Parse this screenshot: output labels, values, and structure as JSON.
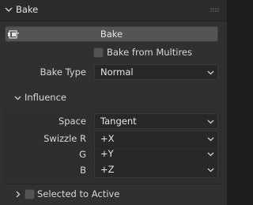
{
  "panel": {
    "title": "Bake",
    "bake_button": "Bake",
    "bake_from_multires": {
      "label": "Bake from Multires",
      "checked": false
    },
    "bake_type": {
      "label": "Bake Type",
      "value": "Normal"
    }
  },
  "influence": {
    "title": "Influence",
    "space": {
      "label": "Space",
      "value": "Tangent"
    },
    "swizzle_r": {
      "label": "Swizzle R",
      "value": "+X"
    },
    "swizzle_g": {
      "label": "G",
      "value": "+Y"
    },
    "swizzle_b": {
      "label": "B",
      "value": "+Z"
    }
  },
  "selected_to_active": {
    "label": "Selected to Active",
    "checked": false
  },
  "colors": {
    "panel_bg": "#303030",
    "header_bg": "#2b2b2b",
    "button_bg": "#545454",
    "dropdown_bg": "#282828",
    "text": "#d9d9d9"
  }
}
